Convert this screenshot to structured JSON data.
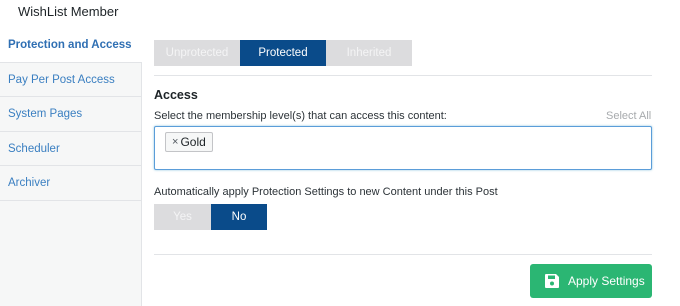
{
  "header": {
    "title": "WishList Member"
  },
  "sidebar": {
    "items": [
      {
        "label": "Protection and Access"
      },
      {
        "label": "Pay Per Post Access"
      },
      {
        "label": "System Pages"
      },
      {
        "label": "Scheduler"
      },
      {
        "label": "Archiver"
      }
    ]
  },
  "protection": {
    "options": [
      "Unprotected",
      "Protected",
      "Inherited"
    ],
    "selected": "Protected"
  },
  "access": {
    "title": "Access",
    "help": "Select the membership level(s) that can access this content:",
    "select_all": "Select All",
    "levels": [
      {
        "remove": "×",
        "name": "Gold"
      }
    ]
  },
  "auto_apply": {
    "label": "Automatically apply Protection Settings to new Content under this Post",
    "options": [
      "Yes",
      "No"
    ],
    "selected": "No"
  },
  "apply_button": {
    "label": "Apply Settings",
    "icon": "floppy-disk-icon"
  },
  "colors": {
    "accent": "#0a4b8a",
    "success": "#2bb673",
    "link": "#3a7fc1"
  }
}
